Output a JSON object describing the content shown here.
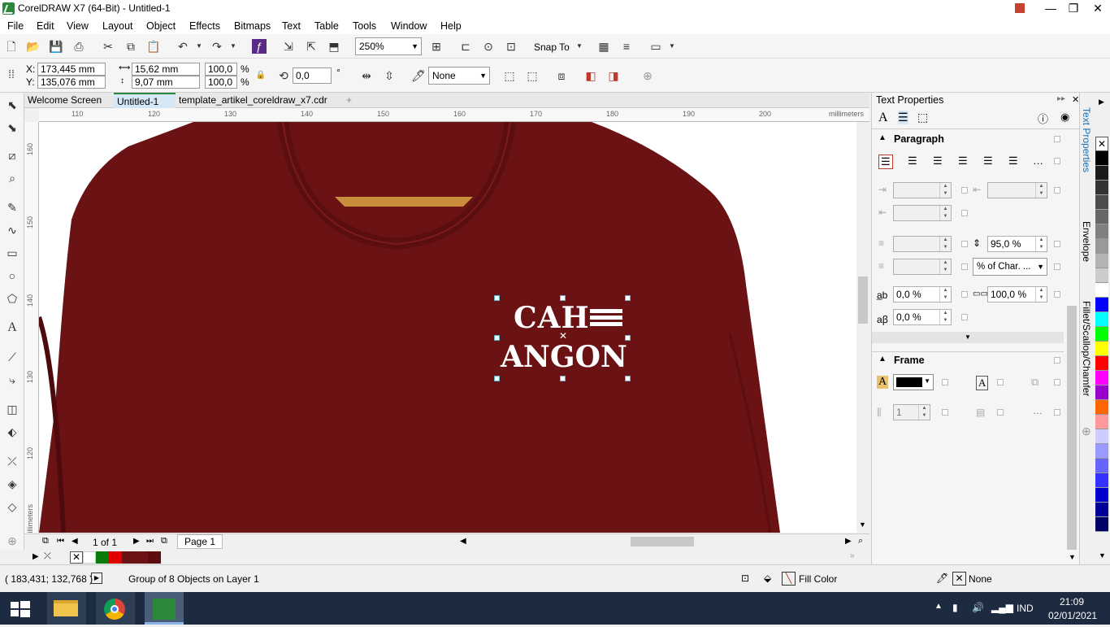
{
  "window": {
    "title": "CorelDRAW X7 (64-Bit) - Untitled-1"
  },
  "menu": [
    "File",
    "Edit",
    "View",
    "Layout",
    "Object",
    "Effects",
    "Bitmaps",
    "Text",
    "Table",
    "Tools",
    "Window",
    "Help"
  ],
  "toolbar": {
    "zoom": "250%",
    "snap": "Snap To"
  },
  "propbar": {
    "x": "173,445 mm",
    "y": "135,076 mm",
    "width": "15,62 mm",
    "height": "9,07 mm",
    "scale_x": "100,0",
    "scale_y": "100,0",
    "percent": "%",
    "rotation": "0,0",
    "degree": "°",
    "outline": "None",
    "x_label": "X:",
    "y_label": "Y:"
  },
  "tabs": [
    "Welcome Screen",
    "Untitled-1",
    "template_artikel_coreldraw_x7.cdr"
  ],
  "ruler": {
    "h_ticks": [
      "110",
      "120",
      "130",
      "140",
      "150",
      "160",
      "170",
      "180",
      "190",
      "200"
    ],
    "unit": "millimeters",
    "v_ticks": [
      "160",
      "150",
      "140",
      "130",
      "120"
    ]
  },
  "design": {
    "line1": "CAH",
    "line2": "ANGON"
  },
  "pagebar": {
    "page_count": "1 of 1",
    "page_tab": "Page 1"
  },
  "docker": {
    "title": "Text Properties",
    "paragraph": "Paragraph",
    "line_spacing": "95,0 %",
    "spacing_unit": "% of Char. ...",
    "char_spacing": "0,0 %",
    "word_spacing": "100,0 %",
    "lang_spacing": "0,0 %",
    "frame": "Frame",
    "columns": "1"
  },
  "vtabs": [
    "Text Properties",
    "Envelope",
    "Fillet/Scallop/Chamfer"
  ],
  "status": {
    "coords": "( 183,431; 132,768 )",
    "selection": "Group of 8 Objects on Layer 1",
    "fill": "Fill Color",
    "outline": "None"
  },
  "taskbar": {
    "lang": "IND",
    "time": "21:09",
    "date": "02/01/2021"
  },
  "colors": {
    "shirt": "#6b1215",
    "accent": "#2a8a3a",
    "selection": "#5fb3c8"
  }
}
